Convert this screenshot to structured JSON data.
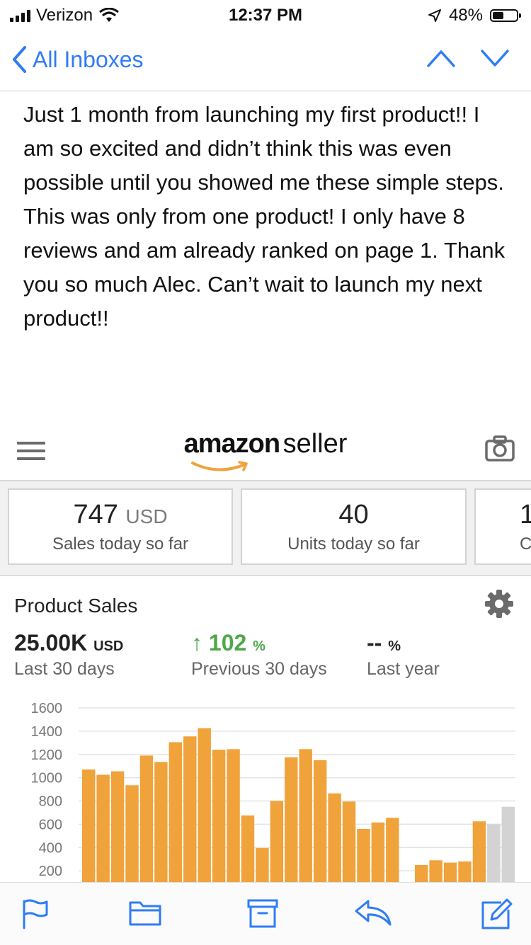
{
  "status": {
    "carrier": "Verizon",
    "time": "12:37 PM",
    "battery": "48%",
    "battery_level": 0.48
  },
  "nav": {
    "back_label": "All Inboxes"
  },
  "message": {
    "text": "Just 1 month from launching my first product!! I am so excited and didn’t think this was even possible until you showed me these simple steps. This was only from one product! I only have 8 reviews and am already ranked on page 1. Thank you so much Alec. Can’t wait to launch my next product!!"
  },
  "seller": {
    "logo_bold": "amazon",
    "logo_word": "seller",
    "tiles": [
      {
        "value": "747",
        "unit": "USD",
        "label": "Sales today so far"
      },
      {
        "value": "40",
        "unit": "",
        "label": "Units today so far"
      },
      {
        "value": "1",
        "unit": "",
        "label": "C"
      }
    ],
    "sales": {
      "title": "Product Sales",
      "metrics": [
        {
          "value": "25.00K",
          "unit": "USD",
          "label": "Last 30 days"
        },
        {
          "arrow": "↑",
          "value": "102",
          "unit": "%",
          "label": "Previous 30 days"
        },
        {
          "value": "--",
          "unit": "%",
          "label": "Last year"
        }
      ]
    }
  },
  "chart_data": {
    "type": "bar",
    "ylim": [
      0,
      1600
    ],
    "yticks": [
      "1600",
      "1400",
      "1200",
      "1000",
      "800",
      "600",
      "400",
      "200"
    ],
    "grid": true,
    "colors": {
      "actual": "#f0a23b",
      "projected": "#d3d3d3"
    },
    "values": [
      1070,
      1025,
      1055,
      935,
      1190,
      1135,
      1305,
      1355,
      1425,
      1240,
      1245,
      675,
      395,
      800,
      1175,
      1245,
      1150,
      865,
      795,
      560,
      615,
      655,
      20,
      250,
      290,
      270,
      280,
      625,
      600,
      750
    ],
    "projected_from_index": 28
  }
}
